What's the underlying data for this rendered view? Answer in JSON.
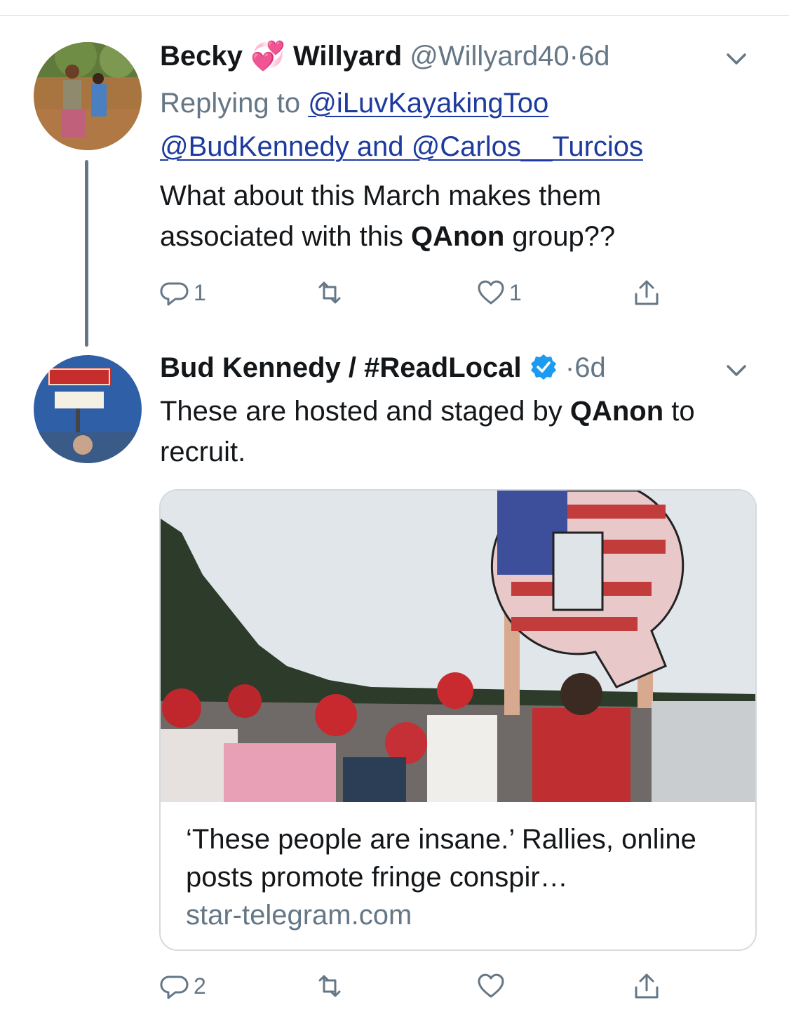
{
  "tweets": [
    {
      "display_name_first": "Becky",
      "display_name_emoji": "💞",
      "display_name_last": "Willyard",
      "handle": "@Willyard40",
      "separator": "·",
      "time": "6d",
      "replying_prefix": "Replying to",
      "reply_user_1": "@iLuvKayakingToo",
      "reply_user_2": "@BudKennedy",
      "reply_and": "and",
      "reply_user_3": "@Carlos__Turcios",
      "text_part1": "What about this March makes them associated with this ",
      "text_bold": "QAnon",
      "text_part2": " group??",
      "reply_count": "1",
      "retweet_count": "",
      "like_count": "1"
    },
    {
      "display_name": "Bud Kennedy / #ReadLocal",
      "verified": true,
      "separator": "·",
      "time": "6d",
      "text_part1": "These are hosted and staged by ",
      "text_bold": "QAnon",
      "text_part2": " to recruit.",
      "card": {
        "title": "‘These people are insane.’ Rallies, online posts promote fringe conspir…",
        "domain": "star-telegram.com"
      },
      "reply_count": "2",
      "retweet_count": "",
      "like_count": ""
    }
  ],
  "colors": {
    "text": "#14171a",
    "secondary": "#657786",
    "link": "#1d3a9e",
    "verified": "#1d9bf0",
    "border": "#d6d9dc"
  },
  "icons": [
    "chevron-down-icon",
    "reply-icon",
    "retweet-icon",
    "like-icon",
    "share-icon",
    "verified-badge-icon"
  ]
}
